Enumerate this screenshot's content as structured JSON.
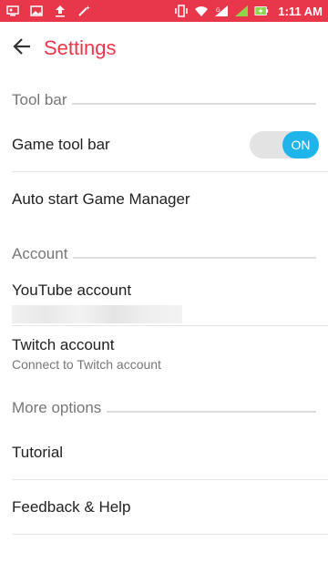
{
  "status_bar": {
    "time": "1:11 AM",
    "icons": [
      "screen-record-icon",
      "gallery-icon",
      "upload-icon",
      "magic-wand-icon",
      "vibrate-icon",
      "wifi-icon",
      "signal-icon",
      "signal-2-icon",
      "battery-charging-icon"
    ],
    "color": "#e8374a"
  },
  "header": {
    "title": "Settings",
    "back_icon": "arrow-left-icon",
    "accent": "#e8374a"
  },
  "sections": {
    "toolbar": {
      "label": "Tool bar",
      "game_tool_bar": {
        "label": "Game tool bar",
        "toggle": "ON"
      },
      "auto_start": {
        "label": "Auto start Game Manager"
      }
    },
    "account": {
      "label": "Account",
      "youtube": {
        "label": "YouTube account"
      },
      "twitch": {
        "label": "Twitch account",
        "subtitle": "Connect to Twitch account"
      }
    },
    "more": {
      "label": "More options",
      "tutorial": {
        "label": "Tutorial"
      },
      "feedback": {
        "label": "Feedback & Help"
      }
    }
  },
  "toggle_color": "#1fb5ea"
}
